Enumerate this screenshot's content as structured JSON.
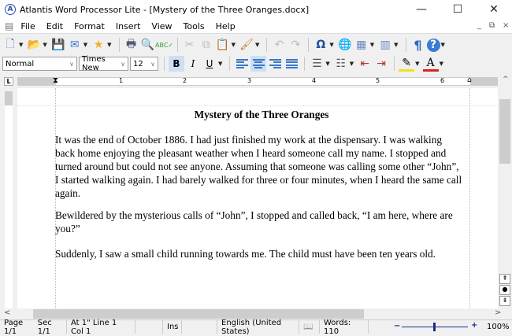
{
  "window": {
    "title": "Atlantis Word Processor Lite - [Mystery of the Three Oranges.docx]",
    "minimize": "—",
    "maximize": "☐",
    "close": "✕"
  },
  "menu": [
    "File",
    "Edit",
    "Format",
    "Insert",
    "View",
    "Tools",
    "Help"
  ],
  "format": {
    "style": "Normal",
    "font": "Times New",
    "size": "12",
    "bold": "B",
    "italic": "I",
    "underline": "U",
    "font_color_glyph": "A"
  },
  "ruler": {
    "labels": [
      "1",
      "2",
      "3",
      "4",
      "5",
      "6"
    ],
    "corner": "L"
  },
  "document": {
    "title": "Mystery of the Three Oranges",
    "p1": [
      "It was the end of October 1886. I had just finished my work at the dispensary. I was walking",
      "back home enjoying the pleasant weather when I heard someone call my name. I stopped and",
      "turned around but could not see anyone. Assuming that someone was calling some other “John”,",
      "I started walking again. I had barely walked for three or four minutes, when I heard the same call",
      "again."
    ],
    "p2": [
      "Bewildered by the mysterious calls of “John”, I stopped and called back, “I am here, where are",
      "you?”"
    ],
    "p3": [
      "Suddenly, I saw a small child running towards me. The child must have been ten years old."
    ]
  },
  "status": {
    "page": "Page 1/1",
    "sec": "Sec 1/1",
    "pos": "At 1\"  Line 1  Col 1",
    "ins": "Ins",
    "lang": "English (United States)",
    "words": "Words: 110",
    "zoom": "100%",
    "zoom_level": 100
  }
}
